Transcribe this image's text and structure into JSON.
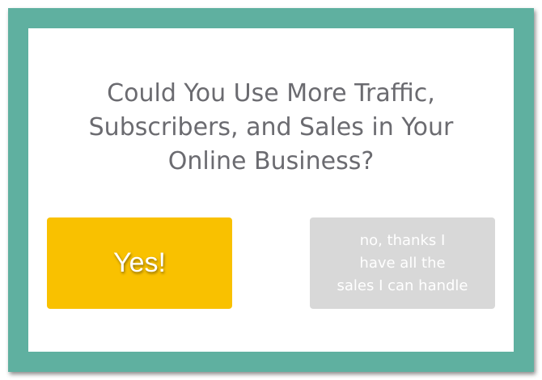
{
  "popup": {
    "headline_lines": [
      "Could You Use More Traffic,",
      "Subscribers, and Sales in Your",
      "Online Business?"
    ],
    "yes_button_label": "Yes!",
    "no_button_lines": [
      "no, thanks I",
      "have all the",
      "sales I can handle"
    ]
  },
  "colors": {
    "frame_border": "#5fb0a0",
    "yes_button": "#f9c100",
    "no_button": "#d8d8d8",
    "headline_text": "#6b6b70"
  }
}
